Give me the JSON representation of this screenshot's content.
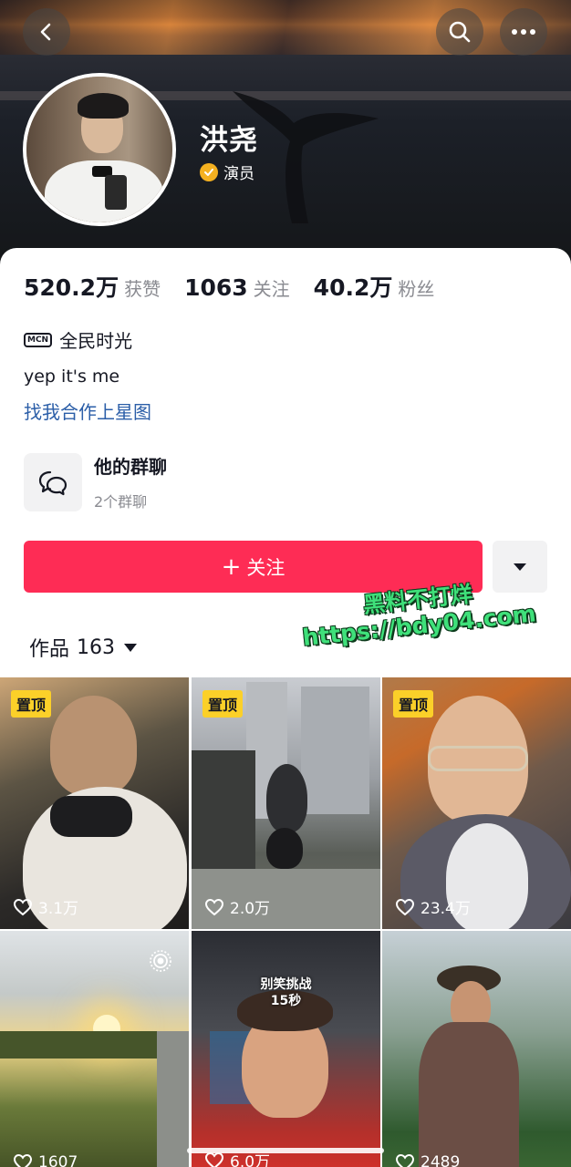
{
  "header": {
    "back_icon": "chevron-left-icon",
    "search_icon": "search-icon",
    "more_icon": "more-horizontal-icon",
    "name": "洪尧",
    "verification": "演员",
    "verify_color": "#f5b120"
  },
  "stats": [
    {
      "value": "520.2万",
      "label": "获赞"
    },
    {
      "value": "1063",
      "label": "关注"
    },
    {
      "value": "40.2万",
      "label": "粉丝"
    }
  ],
  "mcn": {
    "tag": "MCN",
    "text": "全民时光"
  },
  "bio": "yep it's me",
  "bio_link": "找我合作上星图",
  "group_chat": {
    "title": "他的群聊",
    "subtitle": "2个群聊"
  },
  "follow_button": {
    "label": "关注",
    "color": "#fe2c55"
  },
  "watermark": {
    "line1": "黑料不打烊",
    "line2": "https://bdy04.com"
  },
  "works": {
    "label": "作品",
    "count": "163"
  },
  "videos": [
    {
      "pinned": "置顶",
      "likes": "3.1万"
    },
    {
      "pinned": "置顶",
      "likes": "2.0万"
    },
    {
      "pinned": "置顶",
      "likes": "23.4万"
    },
    {
      "pinned": "",
      "likes": "1607"
    },
    {
      "pinned": "",
      "likes": "6.0万",
      "caption_line1": "别笑挑战",
      "caption_line2": "15秒"
    },
    {
      "pinned": "",
      "likes": "2489"
    }
  ]
}
